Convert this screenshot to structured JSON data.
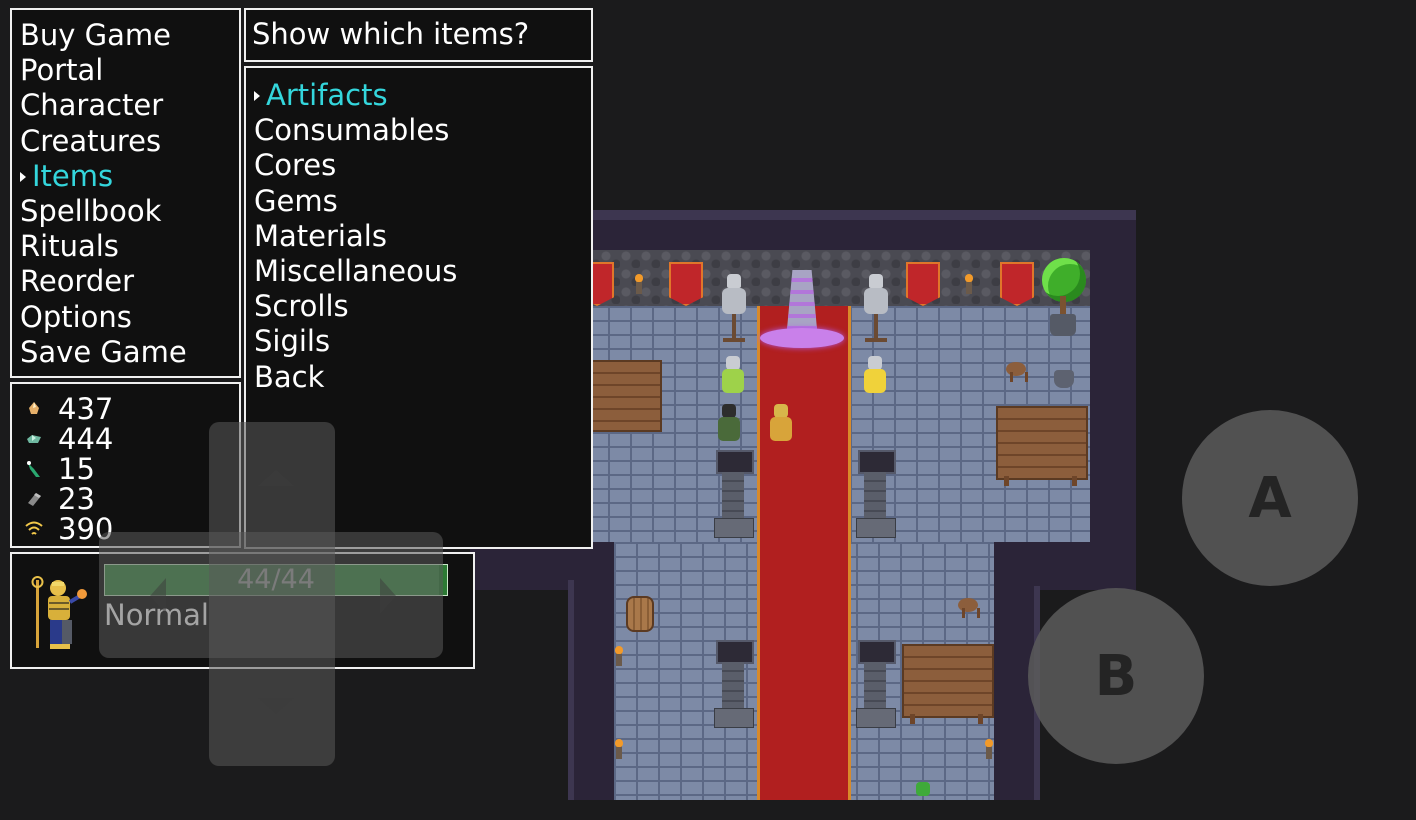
{
  "main_menu": {
    "items": [
      {
        "label": "Buy Game",
        "selected": false
      },
      {
        "label": "Portal",
        "selected": false
      },
      {
        "label": "Character",
        "selected": false
      },
      {
        "label": "Creatures",
        "selected": false
      },
      {
        "label": "Items",
        "selected": true
      },
      {
        "label": "Spellbook",
        "selected": false
      },
      {
        "label": "Rituals",
        "selected": false
      },
      {
        "label": "Reorder",
        "selected": false
      },
      {
        "label": "Options",
        "selected": false
      },
      {
        "label": "Save Game",
        "selected": false
      }
    ]
  },
  "items_prompt": "Show which items?",
  "items_menu": {
    "items": [
      {
        "label": "Artifacts",
        "selected": true
      },
      {
        "label": "Consumables",
        "selected": false
      },
      {
        "label": "Cores",
        "selected": false
      },
      {
        "label": "Gems",
        "selected": false
      },
      {
        "label": "Materials",
        "selected": false
      },
      {
        "label": "Miscellaneous",
        "selected": false
      },
      {
        "label": "Scrolls",
        "selected": false
      },
      {
        "label": "Sigils",
        "selected": false
      },
      {
        "label": "Back",
        "selected": false
      }
    ]
  },
  "resources": [
    {
      "icon": "brimstone-icon",
      "value": "437"
    },
    {
      "icon": "crystal-icon",
      "value": "444"
    },
    {
      "icon": "essence-icon",
      "value": "15"
    },
    {
      "icon": "granite-icon",
      "value": "23"
    },
    {
      "icon": "signal-icon",
      "value": "390"
    }
  ],
  "character": {
    "hp_text": "44/44",
    "hp_fraction": 1.0,
    "status": "Normal"
  },
  "controls": {
    "a_label": "A",
    "b_label": "B"
  },
  "colors": {
    "selected_text": "#34d6dc",
    "hp_bar": "#3e8f48",
    "carpet": "#b11f1f",
    "floor": "#7d8aa6",
    "wall": "#2b2438"
  }
}
